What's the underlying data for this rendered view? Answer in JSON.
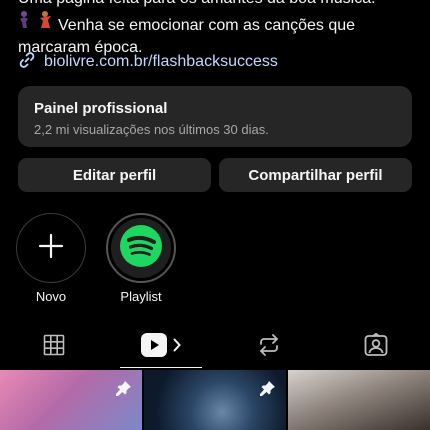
{
  "bio": {
    "line1": "Uma página feita para os amantes da boa música.",
    "line2": "Venha se emocionar com as canções que",
    "line3": "marcaram época.",
    "link": "biolivre.com.br/flashbacksuccess"
  },
  "professional_panel": {
    "title": "Painel profissional",
    "subtitle": "2,2 mi visualizações nos últimos 30 dias."
  },
  "buttons": {
    "edit": "Editar perfil",
    "share": "Compartilhar perfil"
  },
  "highlights": [
    {
      "label": "Novo",
      "icon": "plus-icon"
    },
    {
      "label": "Playlist",
      "icon": "spotify-icon"
    }
  ],
  "tabs": [
    {
      "name": "grid",
      "icon": "grid-icon",
      "active": false
    },
    {
      "name": "reels",
      "icon": "play-icon",
      "active": true
    },
    {
      "name": "reposts",
      "icon": "repost-icon",
      "active": false
    },
    {
      "name": "tagged",
      "icon": "tagged-user-icon",
      "active": false
    }
  ],
  "colors": {
    "background": "#000000",
    "surface": "#262626",
    "spotify": "#1ed760",
    "secondary_text": "#a8a8a8"
  }
}
